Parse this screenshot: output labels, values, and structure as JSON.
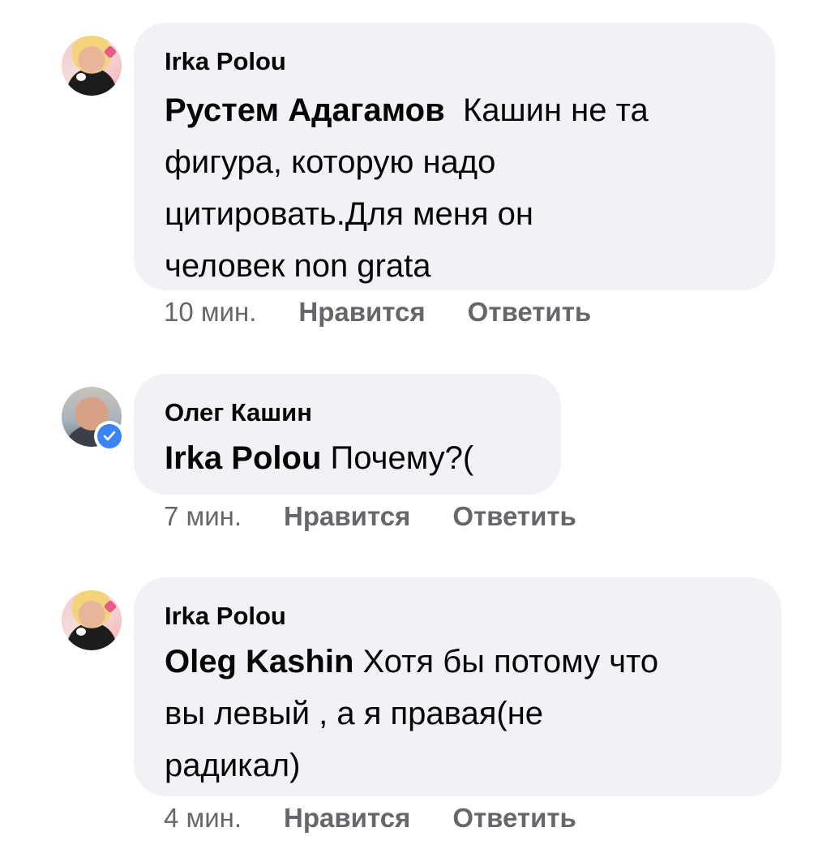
{
  "comments": [
    {
      "author": "Irka Polou",
      "mention": "Рустем Адагамов",
      "text_lines": [
        "Кашин не та",
        "фигура, которую надо",
        "цитировать.Для меня он",
        "человек non grata"
      ],
      "time": "10 мин.",
      "like_label": "Нравится",
      "reply_label": "Ответить"
    },
    {
      "author": "Олег Кашин",
      "mention": "Irka Polou",
      "text_lines": [
        "Почему?("
      ],
      "time": "7 мин.",
      "like_label": "Нравится",
      "reply_label": "Ответить",
      "verified": true
    },
    {
      "author": "Irka Polou",
      "mention": "Oleg Kashin",
      "text_lines": [
        "Хотя бы потому что",
        "вы левый , а я правая(не",
        "радикал)"
      ],
      "time": "4 мин.",
      "like_label": "Нравится",
      "reply_label": "Ответить"
    }
  ],
  "colors": {
    "bubble": "#f0f2f5",
    "meta": "#65676b",
    "verified": "#3b84f5"
  },
  "icons": {
    "verified_badge": "verified-check-icon"
  }
}
